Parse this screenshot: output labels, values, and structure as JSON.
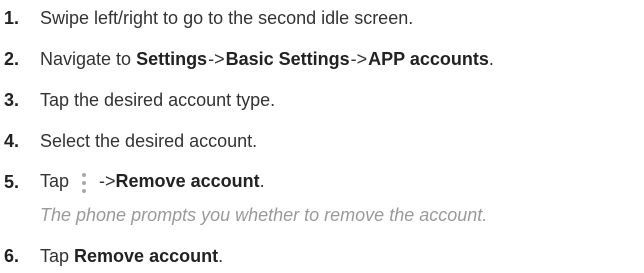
{
  "steps": [
    {
      "num": "1.",
      "text": "Swipe left/right to go to the second idle screen."
    },
    {
      "num": "2.",
      "pre": "Navigate to ",
      "b1": "Settings",
      "sep1": "->",
      "b2": "Basic Settings",
      "sep2": "->",
      "b3": "APP accounts",
      "post": "."
    },
    {
      "num": "3.",
      "text": "Tap the desired account type."
    },
    {
      "num": "4.",
      "text": "Select the desired account."
    },
    {
      "num": "5.",
      "pre": "Tap",
      "icon": "more-vertical-icon",
      "arrow": "->",
      "bold": "Remove account",
      "post": "."
    },
    {
      "num": "6.",
      "pre": "Tap ",
      "bold": "Remove account",
      "post": "."
    }
  ],
  "note": "The phone prompts you whether to remove the account."
}
